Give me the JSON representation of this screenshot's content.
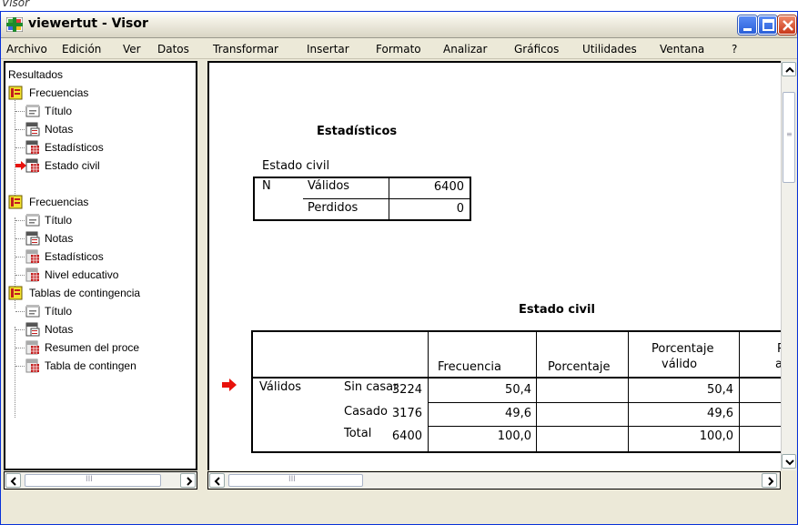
{
  "caption": "Visor",
  "window": {
    "title": "viewertut - Visor"
  },
  "menu": [
    "Archivo",
    "Edición",
    "Ver",
    "Datos",
    "Transformar",
    "Insertar",
    "Formato",
    "Analizar",
    "Gráficos",
    "Utilidades",
    "Ventana",
    "?"
  ],
  "outline": {
    "items": [
      {
        "label": "Resultados",
        "icon": "none"
      },
      {
        "label": "Frecuencias",
        "icon": "book-icon"
      },
      {
        "label": "Título",
        "icon": "title-icon"
      },
      {
        "label": "Notas",
        "icon": "notes-icon"
      },
      {
        "label": "Estadísticos",
        "icon": "table-icon"
      },
      {
        "label": "Estado civil",
        "icon": "table-icon"
      },
      {
        "label": "Frecuencias",
        "icon": "book-icon"
      },
      {
        "label": "Título",
        "icon": "title-icon"
      },
      {
        "label": "Notas",
        "icon": "notes-icon"
      },
      {
        "label": "Estadísticos",
        "icon": "table-icon"
      },
      {
        "label": "Nivel educativo",
        "icon": "table-icon"
      },
      {
        "label": "Tablas de contingencia",
        "icon": "book-icon"
      },
      {
        "label": "Título",
        "icon": "title-icon"
      },
      {
        "label": "Notas",
        "icon": "notes-icon"
      },
      {
        "label": "Resumen del proce",
        "icon": "table-icon"
      },
      {
        "label": "Tabla de contingen",
        "icon": "table-icon"
      }
    ]
  },
  "stats_table": {
    "title": "Estadísticos",
    "subtitle": "Estado civil",
    "row_n": "N",
    "valid_label": "Válidos",
    "valid_value": "6400",
    "missing_label": "Perdidos",
    "missing_value": "0"
  },
  "freq_table": {
    "title": "Estado civil",
    "headers": [
      "Frecuencia",
      "Porcentaje",
      "Porcentaje",
      "válido",
      "P",
      "a"
    ],
    "group": "Válidos",
    "rows": [
      {
        "label": "Sin casar",
        "freq": "3224",
        "pct": "50,4",
        "valid_pct": "50,4"
      },
      {
        "label": "Casado",
        "freq": "3176",
        "pct": "49,6",
        "valid_pct": "49,6"
      },
      {
        "label": "Total",
        "freq": "6400",
        "pct": "100,0",
        "valid_pct": "100,0"
      }
    ]
  },
  "scroll": {
    "thumb_text": "III"
  },
  "colors": {
    "accent_red": "#e8120c",
    "title_blue": "#0831d9"
  }
}
